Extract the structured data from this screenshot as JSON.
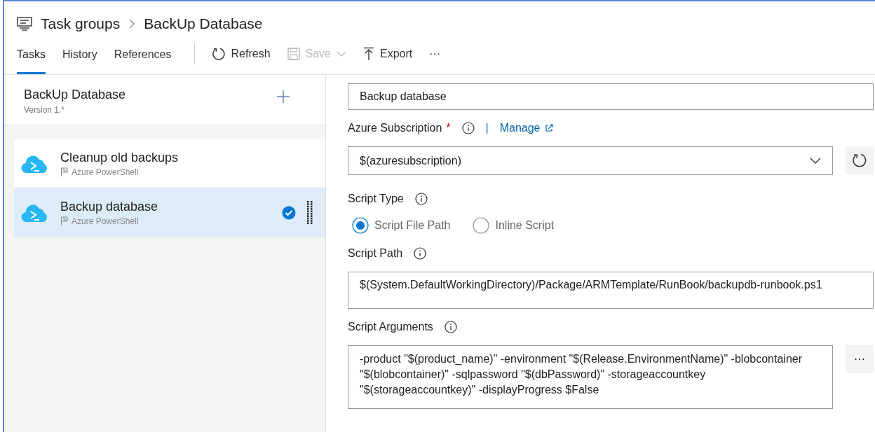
{
  "breadcrumb": {
    "parent": "Task groups",
    "current": "BackUp Database"
  },
  "tabs": [
    {
      "label": "Tasks",
      "selected": true
    },
    {
      "label": "History",
      "selected": false
    },
    {
      "label": "References",
      "selected": false
    }
  ],
  "toolbar": [
    {
      "kind": "refresh",
      "label": "Refresh",
      "disabled": false
    },
    {
      "kind": "save",
      "label": "Save",
      "disabled": true
    },
    {
      "kind": "export",
      "label": "Export",
      "disabled": false
    },
    {
      "kind": "more",
      "label": "···",
      "disabled": false
    }
  ],
  "group": {
    "title": "BackUp Database",
    "version": "Version 1.*"
  },
  "tasks": [
    {
      "name": "Cleanup old backups",
      "type": "Azure PowerShell",
      "selected": false
    },
    {
      "name": "Backup database",
      "type": "Azure PowerShell",
      "selected": true
    }
  ],
  "form": {
    "display_name": "Backup database",
    "subscription": {
      "label": "Azure Subscription",
      "required_mark": "*",
      "separator": "|",
      "manage": "Manage",
      "value": "$(azuresubscription)"
    },
    "script_type": {
      "label": "Script Type",
      "options": [
        {
          "label": "Script File Path",
          "selected": true
        },
        {
          "label": "Inline Script",
          "selected": false
        }
      ]
    },
    "script_path": {
      "label": "Script Path",
      "value": "$(System.DefaultWorkingDirectory)/Package/ARMTemplate/RunBook/backupdb-runbook.ps1"
    },
    "script_arguments": {
      "label": "Script Arguments",
      "value": "-product \"$(product_name)\" -environment \"$(Release.EnvironmentName)\" -blobcontainer \"$(blobcontainer)\" -sqlpassword \"$(dbPassword)\" -storageaccountkey \"$(storageaccountkey)\" -displayProgress $False",
      "more": "···"
    }
  }
}
